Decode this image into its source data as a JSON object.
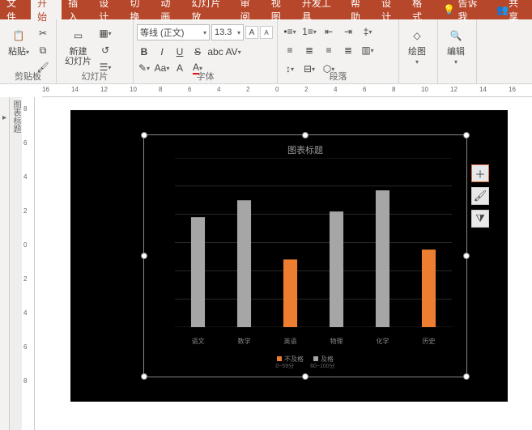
{
  "tabs": {
    "file": "文件",
    "home": "开始",
    "insert": "插入",
    "design": "设计",
    "transitions": "切换",
    "animations": "动画",
    "slideshow": "幻灯片放",
    "review": "审阅",
    "view": "视图",
    "developer": "开发工具",
    "help": "帮助",
    "design2": "设计",
    "format": "格式",
    "tellme": "告诉我",
    "share": "共享"
  },
  "groups": {
    "clipboard": "剪贴板",
    "slides": "幻灯片",
    "font": "字体",
    "paragraph": "段落",
    "drawing": "绘图",
    "editing": "编辑"
  },
  "buttons": {
    "paste": "粘贴",
    "newslide": "新建\n幻灯片",
    "drawing": "绘图",
    "editing": "编辑"
  },
  "font": {
    "name": "等线 (正文)",
    "size": "13.3"
  },
  "ruler": {
    "marks": [
      "16",
      "14",
      "12",
      "10",
      "8",
      "6",
      "4",
      "2",
      "0",
      "2",
      "4",
      "6",
      "8",
      "10",
      "12",
      "14",
      "16"
    ],
    "vmarks": [
      "8",
      "6",
      "4",
      "2",
      "0",
      "2",
      "4",
      "6",
      "8"
    ]
  },
  "outline": "图表标题",
  "chart_data": {
    "type": "bar",
    "title": "图表标题",
    "categories": [
      "语文",
      "数学",
      "英语",
      "物理",
      "化学",
      "历史"
    ],
    "series": [
      {
        "name": "不及格",
        "color": "#ed7d31",
        "values": [
          0,
          0,
          48,
          0,
          0,
          55
        ],
        "range": "0~59分"
      },
      {
        "name": "及格",
        "color": "#a6a6a6",
        "values": [
          78,
          90,
          0,
          82,
          97,
          0
        ],
        "range": "60~100分"
      }
    ],
    "ylim": [
      0,
      120
    ],
    "yticks": [
      0,
      20,
      40,
      60,
      80,
      100,
      120
    ]
  }
}
